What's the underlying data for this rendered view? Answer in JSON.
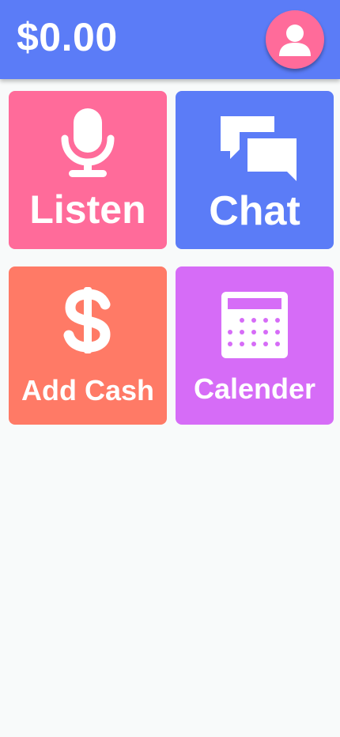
{
  "header": {
    "balance": "$0.00",
    "avatar_icon": "user-icon",
    "background": "#5b7cf7",
    "avatar_color": "#ff6b9a"
  },
  "tiles": [
    {
      "label": "Listen",
      "icon": "microphone-icon",
      "color": "#ff6b9a"
    },
    {
      "label": "Chat",
      "icon": "chat-bubbles-icon",
      "color": "#5b7cf7"
    },
    {
      "label": "Add Cash",
      "icon": "dollar-icon",
      "color": "#ff7a66"
    },
    {
      "label": "Calender",
      "icon": "calendar-icon",
      "color": "#d66cf7"
    }
  ]
}
